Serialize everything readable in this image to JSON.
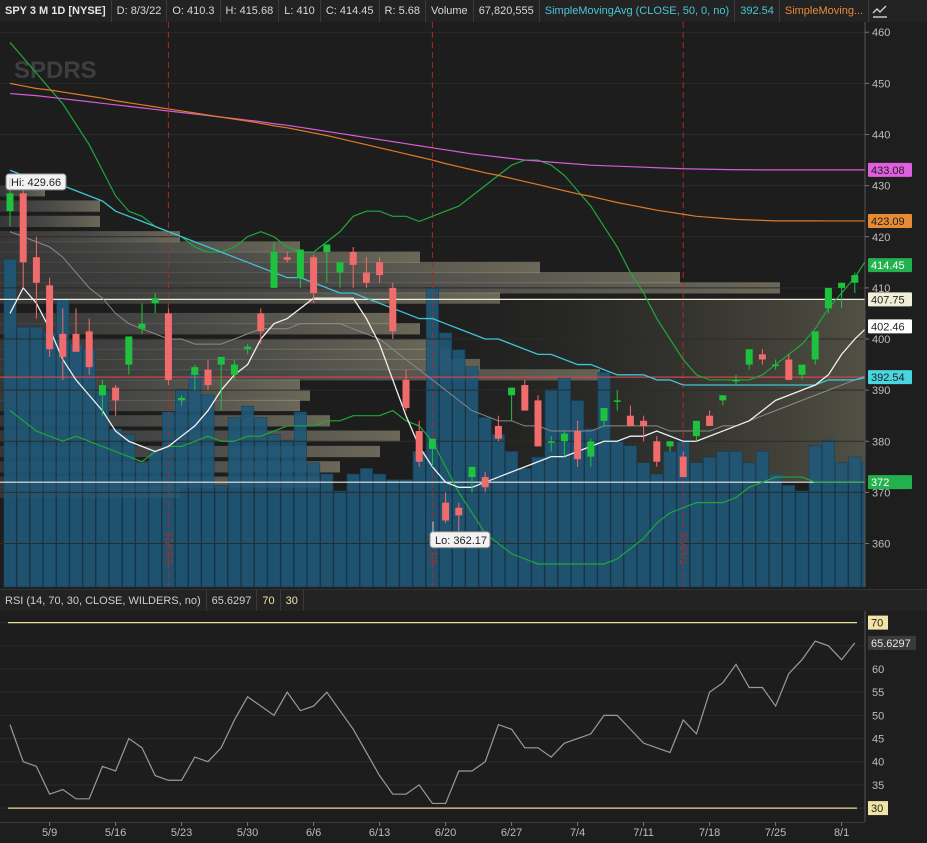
{
  "header": {
    "symbol": "SPY 3 M 1D [NYSE]",
    "date": "D: 8/3/22",
    "open": "O: 410.3",
    "high": "H: 415.68",
    "low": "L: 410",
    "close": "C: 414.45",
    "range": "R: 5.68",
    "volume_label": "Volume",
    "volume_value": "67,820,555",
    "sma50_label": "SimpleMovingAvg (CLOSE, 50, 0, no)",
    "sma50_value": "392.54",
    "sma2_label": "SimpleMoving..."
  },
  "watermark": "SPDRS",
  "price_axis": {
    "ticks": [
      460,
      450,
      440,
      430,
      420,
      410,
      400,
      390,
      380,
      370,
      360
    ],
    "range": [
      351.5,
      462
    ]
  },
  "price_labels": [
    {
      "text": "433.08",
      "value": 433.08,
      "color": "#e05ee0",
      "fg": "#1e1e1e"
    },
    {
      "text": "423.09",
      "value": 423.09,
      "color": "#e88b35",
      "fg": "#1e1e1e"
    },
    {
      "text": "414.45",
      "value": 414.45,
      "color": "#22b14c",
      "fg": "#ffffff"
    },
    {
      "text": "407.75",
      "value": 407.75,
      "color": "#f2efd8",
      "fg": "#1e1e1e"
    },
    {
      "text": "402.46",
      "value": 402.46,
      "color": "#ffffff",
      "fg": "#1e1e1e"
    },
    {
      "text": "392.54",
      "value": 392.54,
      "color": "#49d6e0",
      "fg": "#1e1e1e"
    },
    {
      "text": "372",
      "value": 372,
      "color": "#22b14c",
      "fg": "#ffffff"
    }
  ],
  "hi_callout": "Hi: 429.66",
  "lo_callout": "Lo: 362.17",
  "event_labels": [
    "5/20/22",
    "6/17/22",
    "7/15/22"
  ],
  "horizontal_levels": [
    {
      "value": 407.75,
      "color": "#f2efd8"
    },
    {
      "value": 392.54,
      "color": "#c9484f"
    },
    {
      "value": 372,
      "color": "#e9e9e9"
    }
  ],
  "date_ticks": [
    "5/9",
    "5/16",
    "5/23",
    "5/30",
    "6/6",
    "6/13",
    "6/20",
    "6/27",
    "7/4",
    "7/11",
    "7/18",
    "7/25",
    "8/1"
  ],
  "rsi": {
    "label": "RSI (14, 70, 30, CLOSE, WILDERS, no)",
    "value": "65.6297",
    "ob": "70",
    "os": "30",
    "ticks": [
      70,
      65,
      60,
      55,
      50,
      45,
      40,
      35,
      30
    ],
    "range": [
      27,
      72.5
    ],
    "series": [
      48,
      40,
      39,
      33,
      34,
      32,
      32,
      39,
      38,
      45,
      43,
      37,
      36,
      36,
      41,
      40,
      43,
      49,
      54,
      52,
      50,
      55,
      51,
      52,
      55,
      51,
      47,
      42,
      37,
      33,
      33,
      35,
      31,
      31,
      38,
      38,
      40,
      48,
      47,
      43,
      43,
      41,
      44,
      45,
      46,
      50,
      50,
      47,
      44,
      43,
      42,
      49,
      46,
      55,
      57,
      61,
      56,
      56,
      52,
      59,
      62,
      66,
      65,
      62,
      65.63
    ]
  },
  "chart_data": {
    "type": "candlestick",
    "symbol": "SPY",
    "candles": [
      [
        425.0,
        429.66,
        422.0,
        428.5
      ],
      [
        428.5,
        429.0,
        410.0,
        415.0
      ],
      [
        416.0,
        420.0,
        404.0,
        411.0
      ],
      [
        410.5,
        412.0,
        396.5,
        398.0
      ],
      [
        401.0,
        406.0,
        392.0,
        396.5
      ],
      [
        401.0,
        406.0,
        398.0,
        397.5
      ],
      [
        401.5,
        404.0,
        393.0,
        394.5
      ],
      [
        389.0,
        392.0,
        385.0,
        391.0
      ],
      [
        390.5,
        391.0,
        385.0,
        388.0
      ],
      [
        395.0,
        399.0,
        393.0,
        400.5
      ],
      [
        402.0,
        407.0,
        401.0,
        403.0
      ],
      [
        407.0,
        409.0,
        405.0,
        408.0
      ],
      [
        405.0,
        406.0,
        391.0,
        392.0
      ],
      [
        388.0,
        389.0,
        387.0,
        388.5
      ],
      [
        393.0,
        395.0,
        390.0,
        394.5
      ],
      [
        394.0,
        396.0,
        390.0,
        391.0
      ],
      [
        395.0,
        396.0,
        386.0,
        396.5
      ],
      [
        393.0,
        396.0,
        392.0,
        395.0
      ],
      [
        398.0,
        399.0,
        397.0,
        398.5
      ],
      [
        405.0,
        406.0,
        399.0,
        401.5
      ],
      [
        410.0,
        419.0,
        410.0,
        417.0
      ],
      [
        416.0,
        417.0,
        415.0,
        415.5
      ],
      [
        412.0,
        417.0,
        410.0,
        417.5
      ],
      [
        416.0,
        416.5,
        407.0,
        409.0
      ],
      [
        417.0,
        418.0,
        411.0,
        418.5
      ],
      [
        413.0,
        415.0,
        410.0,
        415.0
      ],
      [
        417.0,
        418.0,
        410.0,
        414.5
      ],
      [
        413.0,
        416.0,
        410.0,
        411.0
      ],
      [
        415.0,
        416.0,
        411.0,
        412.5
      ],
      [
        410.0,
        411.0,
        400.0,
        401.5
      ],
      [
        392.0,
        394.0,
        386.0,
        386.5
      ],
      [
        382.0,
        384.0,
        375.0,
        376.0
      ],
      [
        378.5,
        380.0,
        375.0,
        380.5
      ],
      [
        368.0,
        370.0,
        364.0,
        364.5
      ],
      [
        367.0,
        368.0,
        362.17,
        365.5
      ],
      [
        373.0,
        375.0,
        370.0,
        375.0
      ],
      [
        373.0,
        374.0,
        370.0,
        371.0
      ],
      [
        383.0,
        385.0,
        380.0,
        380.5
      ],
      [
        389.0,
        390.0,
        384.0,
        390.5
      ],
      [
        391.0,
        392.0,
        389.0,
        386.0
      ],
      [
        388.0,
        389.0,
        387.0,
        379.0
      ],
      [
        380.0,
        381.0,
        378.0,
        380.0
      ],
      [
        380.0,
        382.0,
        377.0,
        381.5
      ],
      [
        382.0,
        384.0,
        375.0,
        376.5
      ],
      [
        377.0,
        380.5,
        375.0,
        380.0
      ],
      [
        384.0,
        386.0,
        383.0,
        386.5
      ],
      [
        388.0,
        390.0,
        386.0,
        388.0
      ],
      [
        385.0,
        387.0,
        383.0,
        383.0
      ],
      [
        384.0,
        385.0,
        380.0,
        383.0
      ],
      [
        380.0,
        381.0,
        375.0,
        376.0
      ],
      [
        379.0,
        380.0,
        378.0,
        380.0
      ],
      [
        377.0,
        378.0,
        373.0,
        373.0
      ],
      [
        381.0,
        382.0,
        380.0,
        384.0
      ],
      [
        385.0,
        386.0,
        383.0,
        383.0
      ],
      [
        388.0,
        389.0,
        387.0,
        389.0
      ],
      [
        392.0,
        393.0,
        391.0,
        392.0
      ],
      [
        395.0,
        397.0,
        394.0,
        398.0
      ],
      [
        397.0,
        398.0,
        395.0,
        396.0
      ],
      [
        395.0,
        396.0,
        394.0,
        395.0
      ],
      [
        396.0,
        397.0,
        394.0,
        392.0
      ],
      [
        393.0,
        394.0,
        392.0,
        395.0
      ],
      [
        396.0,
        398.0,
        395.0,
        401.5
      ],
      [
        406.0,
        408.0,
        405.0,
        410.0
      ],
      [
        410.0,
        411.0,
        406.0,
        411.0
      ],
      [
        411.0,
        413.0,
        409.0,
        412.5
      ],
      [
        410.3,
        415.68,
        410.0,
        414.45
      ]
    ],
    "sma_short": [
      405,
      410,
      407,
      402,
      396,
      392,
      389,
      386,
      382,
      380,
      379,
      378,
      379,
      381,
      383,
      386,
      390,
      393,
      395,
      400,
      403,
      404,
      406,
      408,
      408,
      408,
      408,
      404,
      399,
      392,
      385,
      379,
      375,
      372,
      371,
      371,
      372,
      373,
      374,
      375,
      376,
      377,
      377,
      378,
      379,
      380,
      380,
      381,
      381,
      382,
      381,
      380,
      380,
      381,
      382,
      383,
      384,
      386,
      388,
      389,
      390,
      391,
      393,
      397,
      400,
      402.46
    ],
    "sma50": [
      433,
      432,
      431,
      431,
      430,
      429,
      428,
      427,
      425,
      424,
      423,
      422,
      421,
      420,
      419,
      418,
      417,
      416,
      415,
      414,
      413,
      412,
      412,
      411,
      410,
      409,
      409,
      408,
      407,
      406,
      405,
      404,
      404,
      403,
      402,
      401,
      400,
      400,
      399,
      398,
      397,
      397,
      396,
      395,
      395,
      394,
      393,
      393,
      393,
      392,
      392,
      391,
      391,
      391,
      391,
      391,
      391,
      391,
      391,
      391,
      391,
      391,
      392,
      392,
      392,
      392.54
    ],
    "sma_long_orange": [
      450,
      449.5,
      449,
      448.7,
      448.3,
      447.9,
      447.5,
      447.1,
      446.6,
      446.2,
      445.8,
      445.4,
      445,
      444.6,
      444.2,
      443.8,
      443.4,
      443,
      442.6,
      442.2,
      441.7,
      441.3,
      440.8,
      440.3,
      439.8,
      439.2,
      438.6,
      438,
      437.4,
      436.8,
      436.2,
      435.6,
      435,
      434.3,
      433.7,
      433.1,
      432.5,
      432,
      431.4,
      430.8,
      430.2,
      429.6,
      429,
      428.4,
      427.9,
      427.3,
      426.7,
      426.2,
      425.7,
      425.2,
      424.8,
      424.4,
      424,
      423.8,
      423.6,
      423.4,
      423.3,
      423.2,
      423.1,
      423.1,
      423.1,
      423.1,
      423.09,
      423.09,
      423.09,
      423.09
    ],
    "sma_long_magenta": [
      448,
      447.8,
      447.6,
      447.3,
      447,
      446.7,
      446.4,
      446.1,
      445.8,
      445.5,
      445.2,
      444.9,
      444.6,
      444.3,
      444,
      443.7,
      443.4,
      443.1,
      442.8,
      442.5,
      442.1,
      441.8,
      441.4,
      441,
      440.6,
      440.2,
      439.8,
      439.4,
      439,
      438.6,
      438.2,
      437.8,
      437.4,
      437,
      436.6,
      436.2,
      435.9,
      435.6,
      435.3,
      435,
      434.8,
      434.6,
      434.4,
      434.2,
      434,
      433.9,
      433.8,
      433.7,
      433.6,
      433.5,
      433.4,
      433.3,
      433.25,
      433.2,
      433.15,
      433.1,
      433.1,
      433.08,
      433.08,
      433.08,
      433.08,
      433.08,
      433.08,
      433.08,
      433.08,
      433.08
    ],
    "bollinger_upper": [
      458,
      455,
      452,
      449,
      446,
      442,
      438,
      433,
      428,
      425,
      424,
      422,
      421,
      420,
      418,
      417,
      417,
      418,
      420,
      421,
      420,
      418,
      417,
      417,
      419,
      421,
      424,
      425,
      425,
      424,
      424,
      423,
      424,
      425,
      426,
      428,
      430,
      432,
      434,
      435,
      435,
      434,
      432,
      429,
      426,
      422,
      418,
      413,
      409,
      404,
      400,
      396,
      393,
      392,
      392,
      392,
      392,
      393,
      395,
      397,
      399,
      402,
      406,
      409,
      412,
      416
    ],
    "bollinger_lower": [
      386,
      384,
      382,
      381,
      380,
      381,
      380,
      379,
      378,
      377,
      376,
      378,
      379,
      379,
      380,
      381,
      380,
      380,
      381,
      381,
      382,
      383,
      383,
      383,
      384,
      384,
      385,
      385,
      385,
      386,
      384,
      383,
      380,
      375,
      370,
      366,
      362,
      360,
      358,
      357,
      356,
      356,
      356,
      356,
      356,
      356,
      357,
      359,
      361,
      364,
      366,
      367,
      368,
      368,
      368,
      369,
      371,
      372,
      373,
      373,
      373,
      372,
      372,
      372,
      372,
      372
    ],
    "sma_gray": [
      421,
      420,
      419,
      418,
      416,
      413,
      410,
      408,
      405,
      403,
      402,
      401,
      400,
      400,
      399,
      399,
      399,
      400,
      401,
      402,
      402,
      402,
      403,
      403,
      403,
      403,
      402,
      401,
      400,
      398,
      396,
      394,
      392,
      390,
      388,
      386,
      385,
      384,
      384,
      383,
      383,
      382,
      382,
      382,
      382,
      383,
      383,
      383,
      383,
      383,
      382,
      382,
      382,
      382,
      383,
      383,
      384,
      385,
      386,
      387,
      388,
      389,
      390,
      391,
      392,
      393
    ],
    "volume_profile": [
      {
        "price": 429,
        "width": 45
      },
      {
        "price": 426,
        "width": 100
      },
      {
        "price": 423,
        "width": 100
      },
      {
        "price": 420,
        "width": 180
      },
      {
        "price": 418,
        "width": 300
      },
      {
        "price": 416,
        "width": 420
      },
      {
        "price": 414,
        "width": 540
      },
      {
        "price": 412,
        "width": 680
      },
      {
        "price": 410,
        "width": 780
      },
      {
        "price": 408,
        "width": 500
      },
      {
        "price": 404,
        "width": 390
      },
      {
        "price": 402,
        "width": 420
      },
      {
        "price": 399,
        "width": 440
      },
      {
        "price": 397,
        "width": 450
      },
      {
        "price": 395,
        "width": 480
      },
      {
        "price": 393,
        "width": 600
      },
      {
        "price": 391,
        "width": 300
      },
      {
        "price": 389,
        "width": 310
      },
      {
        "price": 387,
        "width": 300
      },
      {
        "price": 384,
        "width": 330
      },
      {
        "price": 381,
        "width": 400
      },
      {
        "price": 378,
        "width": 380
      },
      {
        "price": 375,
        "width": 340
      },
      {
        "price": 372,
        "width": 320
      },
      {
        "price": 370,
        "width": 180
      }
    ],
    "volume_bars": [
      0.58,
      0.46,
      0.46,
      0.45,
      0.51,
      0.43,
      0.42,
      0.35,
      0.28,
      0.27,
      0.22,
      0.24,
      0.31,
      0.35,
      0.38,
      0.34,
      0.18,
      0.3,
      0.32,
      0.3,
      0.27,
      0.26,
      0.31,
      0.22,
      0.2,
      0.17,
      0.2,
      0.21,
      0.2,
      0.19,
      0.19,
      0.24,
      0.53,
      0.45,
      0.42,
      0.39,
      0.3,
      0.27,
      0.24,
      0.21,
      0.23,
      0.35,
      0.37,
      0.33,
      0.28,
      0.38,
      0.26,
      0.25,
      0.22,
      0.2,
      0.24,
      0.26,
      0.22,
      0.23,
      0.24,
      0.24,
      0.22,
      0.24,
      0.2,
      0.18,
      0.17,
      0.25,
      0.26,
      0.22,
      0.23,
      0.22
    ]
  }
}
